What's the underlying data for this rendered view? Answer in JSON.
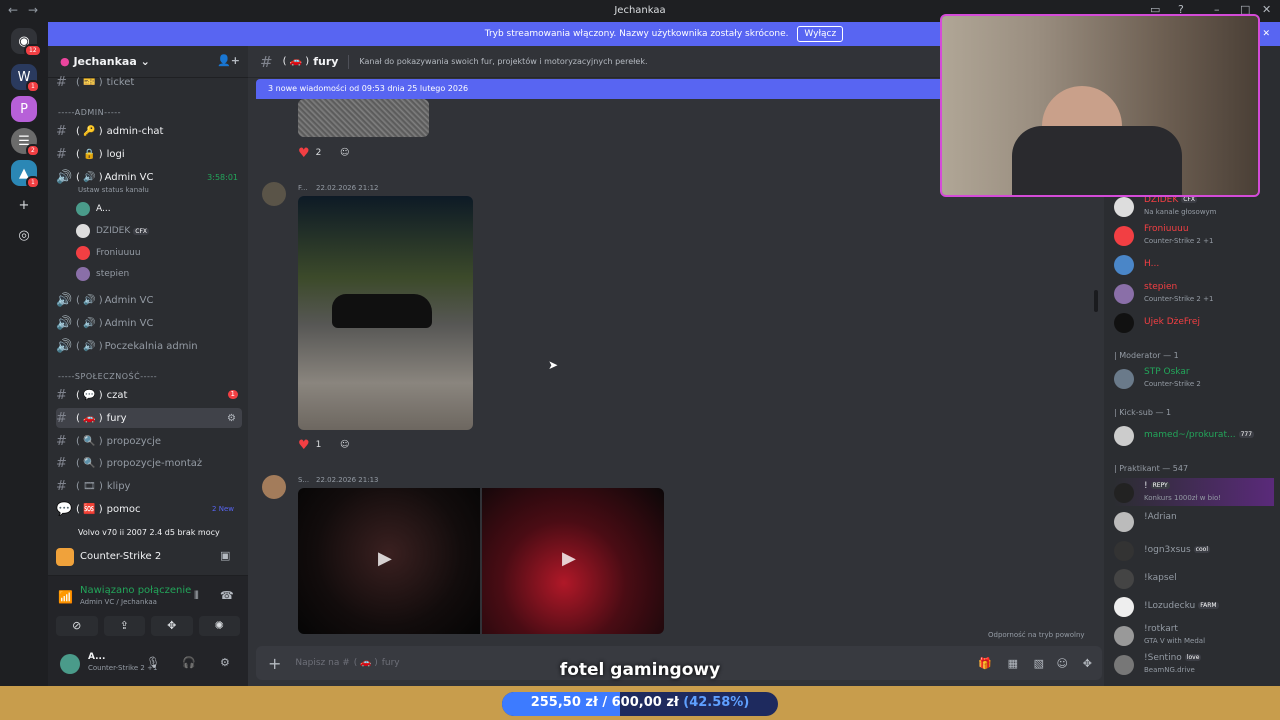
{
  "window": {
    "title": "Jechankaa"
  },
  "banner": {
    "text": "Tryb streamowania włączony. Nazwy użytkownika zostały skrócone.",
    "button": "Wyłącz"
  },
  "servers": [
    {
      "badge": "12"
    },
    {
      "badge": "1"
    },
    {
      "badge": ""
    },
    {
      "badge": "2"
    },
    {
      "badge": "1"
    }
  ],
  "guild": {
    "name": "Jechankaa"
  },
  "channels": {
    "ticket": "ticket",
    "admin_category": "-----ADMIN-----",
    "admin_chat": "admin-chat",
    "logi": "logi",
    "admin_vc": "Admin VC",
    "admin_vc_timer": "3:58:01",
    "admin_vc_status": "Ustaw status kanału",
    "vc_users": [
      {
        "name": "A...",
        "tag": ""
      },
      {
        "name": "DZIDEK",
        "tag": "CFX"
      },
      {
        "name": "Froniuuuu",
        "tag": ""
      },
      {
        "name": "stepien",
        "tag": ""
      }
    ],
    "admin_vc_2": "Admin VC",
    "admin_vc_3": "Admin VC",
    "poczekalnia": "Poczekalnia admin",
    "community_category": "-----SPOŁECZNOŚĆ-----",
    "czat": "czat",
    "czat_badge": "1",
    "fury": "fury",
    "propozycje": "propozycje",
    "propozycje_montaz": "propozycje-montaż",
    "klipy": "klipy",
    "pomoc": "pomoc",
    "pomoc_new": "2 New",
    "thread": "Volvo v70 ii 2007 2.4 d5 brak mocy"
  },
  "activity": {
    "game": "Counter-Strike 2"
  },
  "voice": {
    "status": "Nawiązano połączenie",
    "location": "Admin VC / Jechankaa"
  },
  "user": {
    "name": "A...",
    "activity": "Counter-Strike 2 +1"
  },
  "header": {
    "channel": "fury",
    "topic": "Kanał do pokazywania swoich fur, projektów i motoryzacyjnych perełek."
  },
  "newbar": {
    "text": "3 nowe wiadomości od 09:53 dnia 25 lutego 2026"
  },
  "messages": [
    {
      "author": "F...",
      "time": "22.02.2026 21:12",
      "reaction_count": "1"
    },
    {
      "author": "S...",
      "time": "22.02.2026 21:13"
    }
  ],
  "prev_reaction_count": "2",
  "slowmode": "Odporność na tryb powolny",
  "composer": {
    "placeholder": "Napisz na #",
    "channel": "fury"
  },
  "members": {
    "top": [
      {
        "name": "DZIDEK",
        "tag": "CFX",
        "activity": "Na kanale głosowym",
        "color": "#f23f43"
      },
      {
        "name": "Froniuuuu",
        "tag": "",
        "activity": "Counter-Strike 2 +1",
        "color": "#f23f43"
      },
      {
        "name": "H...",
        "tag": "",
        "activity": "",
        "color": "#f23f43"
      },
      {
        "name": "stepien",
        "tag": "",
        "activity": "Counter-Strike 2 +1",
        "color": "#f23f43"
      },
      {
        "name": "Ujek DżeFrej",
        "tag": "",
        "activity": "",
        "color": "#f23f43"
      }
    ],
    "moderator_role": "| Moderator — 1",
    "moderators": [
      {
        "name": "STP Oskar",
        "activity": "Counter-Strike 2",
        "color": "#23a55a"
      }
    ],
    "kicksub_role": "| Kick-sub — 1",
    "kicksub": [
      {
        "name": "mamed~/prokurat...",
        "tag": "777",
        "color": "#23a55a"
      }
    ],
    "praktikant_role": "| Praktikant — 547",
    "praktikanci": [
      {
        "name": "!",
        "tag": "REPY",
        "activity": "Konkurs 1000zł w bio!"
      },
      {
        "name": "!Adrian",
        "tag": "",
        "activity": ""
      },
      {
        "name": "!ogn3xsus",
        "tag": "cool",
        "activity": ""
      },
      {
        "name": "!kapsel",
        "tag": "",
        "activity": ""
      },
      {
        "name": "!Lozudecku",
        "tag": "FARM",
        "activity": ""
      },
      {
        "name": "!rotkart",
        "tag": "",
        "activity": "GTA V with Medal"
      },
      {
        "name": "!Sentino",
        "tag": "love",
        "activity": "BeamNG.drive"
      }
    ]
  },
  "overlay": {
    "product": "fotel gamingowy",
    "current": "255,50 zł",
    "goal": "600,00 zł",
    "percent": "(42.58%)",
    "progress": 0.4258
  }
}
